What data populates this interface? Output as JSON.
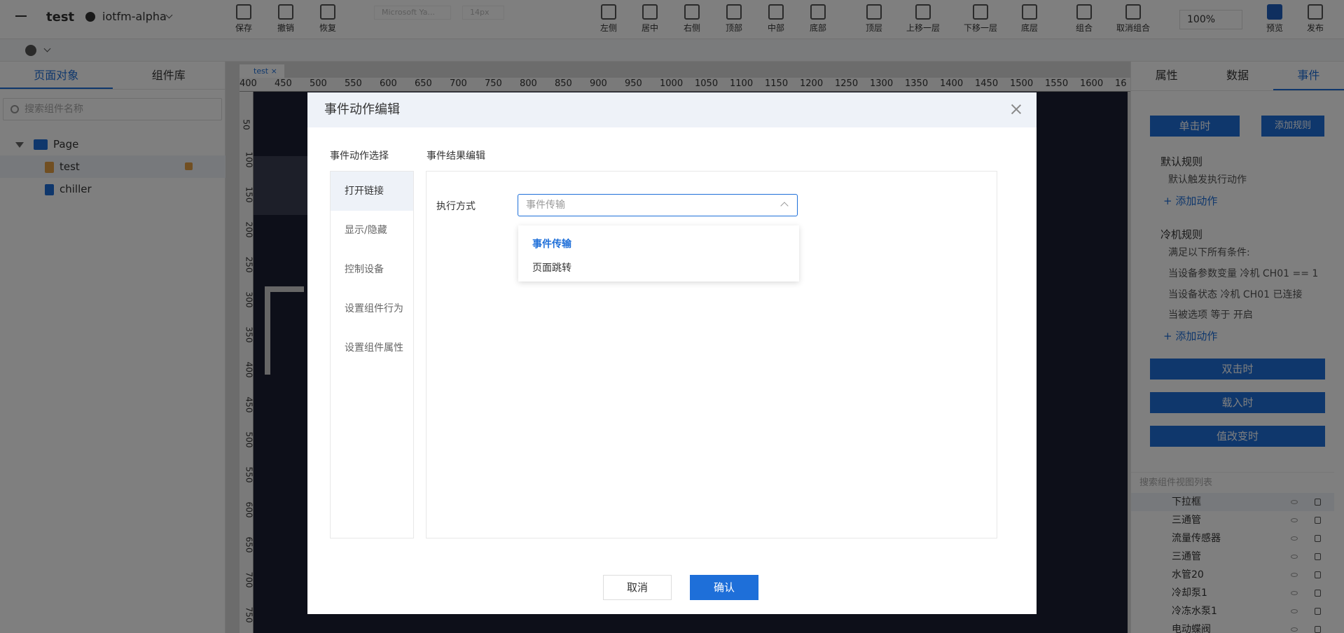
{
  "app": {
    "title": "test",
    "user": "iotfm-alpha"
  },
  "toolbar": {
    "save": "保存",
    "undo": "撤销",
    "redo": "恢复",
    "font_family": "Microsoft Ya...",
    "font_size": "14px",
    "align_left": "左侧",
    "align_center": "居中",
    "align_right": "右侧",
    "align_top": "顶部",
    "align_middle": "中部",
    "align_bottom": "底部",
    "layer_top": "顶层",
    "layer_up": "上移一层",
    "layer_down": "下移一层",
    "layer_bottom": "底层",
    "group": "组合",
    "ungroup": "取消组合",
    "zoom": "100%",
    "preview": "预览",
    "publish": "发布"
  },
  "left_panel": {
    "tabs": [
      "页面对象",
      "组件库"
    ],
    "search_placeholder": "搜索组件名称",
    "tree": [
      "Page",
      "test",
      "chiller"
    ]
  },
  "canvas": {
    "tab": "test",
    "ruler_x": [
      "400",
      "450",
      "500",
      "550",
      "600",
      "650",
      "700",
      "750",
      "800",
      "850",
      "900",
      "950",
      "1000",
      "1050",
      "1100",
      "1150",
      "1200",
      "1250",
      "1300",
      "1350",
      "1400",
      "1450",
      "1500",
      "1550",
      "1600",
      "16"
    ],
    "ruler_y": [
      "50",
      "100",
      "150",
      "200",
      "250",
      "300",
      "350",
      "400",
      "450",
      "500",
      "550",
      "600",
      "650",
      "700",
      "750"
    ]
  },
  "right_panel": {
    "tabs": [
      "属性",
      "数据",
      "事件"
    ],
    "on_click": "单击时",
    "add_rule": "添加规则",
    "default_rule": "默认规则",
    "default_desc": "默认触发执行动作",
    "add_action": "+ 添加动作",
    "chiller_rule": "冷机规则",
    "conditions_title": "满足以下所有条件:",
    "conditions": [
      "当设备参数变量 冷机 CH01 == 1",
      "当设备状态 冷机 CH01 已连接",
      "当被选项 等于 开启"
    ],
    "on_dblclick": "双击时",
    "on_load": "载入时",
    "on_change": "值改变时",
    "view_search": "搜索组件视图列表",
    "components": [
      "下拉框",
      "三通管",
      "流量传感器",
      "三通管",
      "水管20",
      "冷却泵1",
      "冷冻水泵1",
      "电动蝶阀"
    ]
  },
  "modal": {
    "title": "事件动作编辑",
    "left_title": "事件动作选择",
    "right_title": "事件结果编辑",
    "actions": [
      "打开链接",
      "显示/隐藏",
      "控制设备",
      "设置组件行为",
      "设置组件属性"
    ],
    "field_label": "执行方式",
    "select_placeholder": "事件传输",
    "options": [
      "事件传输",
      "页面跳转"
    ],
    "cancel": "取消",
    "confirm": "确认"
  },
  "colors": {
    "accent": "#1e6fd9",
    "canvas_bg": "#1b1f33"
  }
}
